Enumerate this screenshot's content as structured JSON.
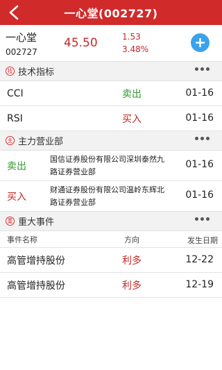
{
  "header": {
    "title": "一心堂(002727)",
    "back_icon": "back-arrow-icon"
  },
  "stock": {
    "name": "一心堂",
    "code": "002727",
    "price": "45.50",
    "change": "1.53",
    "change_pct": "3.48%",
    "add_icon": "plus-icon"
  },
  "sections": {
    "tech": {
      "icon_char": "技",
      "title": "技术指标",
      "rows": [
        {
          "indicator": "CCI",
          "action": "卖出",
          "date": "01-16"
        },
        {
          "indicator": "RSI",
          "action": "买入",
          "date": "01-16"
        }
      ]
    },
    "branch": {
      "icon_char": "主",
      "title": "主力营业部",
      "rows": [
        {
          "action": "卖出",
          "desc": "国信证券股份有限公司深圳泰然九路证券营业部",
          "date": "01-16"
        },
        {
          "action": "买入",
          "desc": "财通证券股份有限公司温岭东辉北路证券营业部",
          "date": "01-16"
        }
      ]
    },
    "events": {
      "icon_char": "重",
      "title": "重大事件",
      "columns": {
        "name": "事件名称",
        "direction": "方向",
        "date": "发生日期"
      },
      "rows": [
        {
          "name": "高管增持股份",
          "direction": "利多",
          "date": "12-22"
        },
        {
          "name": "高管增持股份",
          "direction": "利多",
          "date": "12-19"
        }
      ]
    }
  },
  "colors": {
    "header": "#d12a2a",
    "sell": "#2e9b32",
    "buy": "#c62828",
    "accent": "#3aa2ea"
  }
}
